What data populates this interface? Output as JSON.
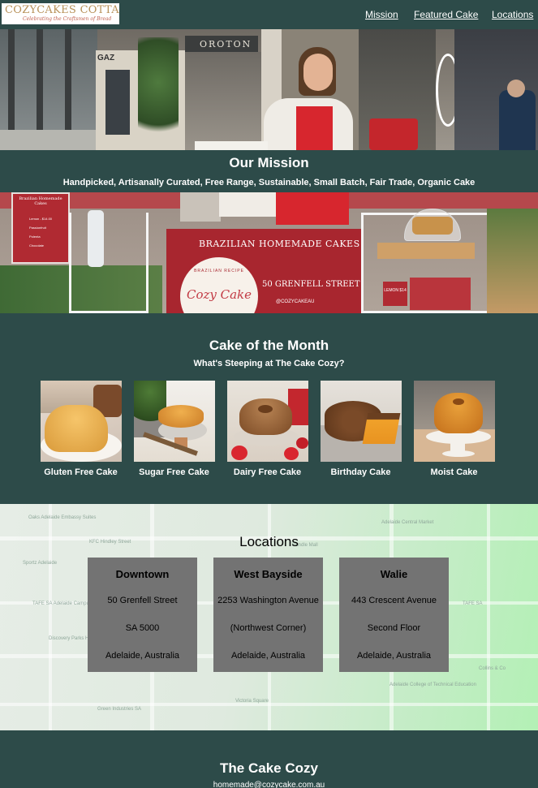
{
  "brand": {
    "name": "COZYCAKES COTTAGE",
    "tagline": "Celebrating the Craftsmen of Bread"
  },
  "nav": {
    "links": [
      "Mission",
      "Featured Cake",
      "Locations"
    ]
  },
  "hero_photo_text": {
    "store_sign": "OROTON",
    "side_sign": "GAZ"
  },
  "mission": {
    "title": "Our Mission",
    "text": "Handpicked, Artisanally Curated, Free Range, Sustainable, Small Batch, Fair Trade, Organic Cake"
  },
  "stall_photo_text": {
    "banner": "BRAZILIAN HOMEMADE CAKES",
    "address": "50 GRENFELL STREET",
    "badge_ring": "BRAZILIAN RECIPE",
    "badge": "Cozy Cake",
    "social": "@COZYCAKEAU",
    "menu_title": "Brazilian Homemade Cakes",
    "menu_items": [
      "Lemon - $14.00",
      "Passionfruit",
      "Polenta",
      "Chocolate"
    ],
    "price_tag": "LEMON $14"
  },
  "cake_of_month": {
    "title": "Cake of the Month",
    "subtitle": "What's Steeping at The Cake Cozy?",
    "cakes": [
      "Gluten Free Cake",
      "Sugar Free Cake",
      "Dairy Free Cake",
      "Birthday Cake",
      "Moist Cake"
    ]
  },
  "locations": {
    "title": "Locations",
    "cards": [
      {
        "name": "Downtown",
        "lines": [
          "50 Grenfell Street",
          "SA 5000",
          "Adelaide, Australia"
        ]
      },
      {
        "name": "West Bayside",
        "lines": [
          "2253 Washington Avenue",
          "(Northwest Corner)",
          "Adelaide, Australia"
        ]
      },
      {
        "name": "Walie",
        "lines": [
          "443 Crescent Avenue",
          "Second Floor",
          "Adelaide, Australia"
        ]
      }
    ],
    "map_labels": [
      "Oaks Adelaide Embassy Suites",
      "KFC Hindley Street",
      "Sportz Adelaide",
      "TAFE SA Adelaide Campus",
      "Discovery Parks Head Office",
      "Adelaide Central Market",
      "Victoria Square",
      "Rundle Mall",
      "Adelaide College of Technical Education",
      "Green Industries SA",
      "TAFE SA",
      "Collins & Co"
    ]
  },
  "footer": {
    "title": "The Cake Cozy",
    "email": "homemade@cozycake.com.au"
  }
}
